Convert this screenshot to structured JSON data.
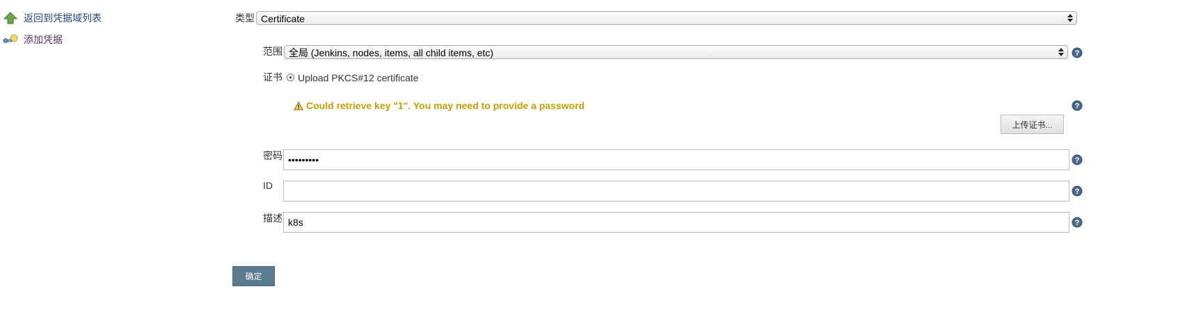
{
  "sidebar": {
    "back_label": "返回到凭据域列表",
    "add_label": "添加凭据"
  },
  "form": {
    "kind": {
      "label": "类型",
      "value": "Certificate"
    },
    "scope": {
      "label": "范围",
      "value": "全局 (Jenkins, nodes, items, all child items, etc)"
    },
    "certificate": {
      "label": "证书",
      "option_label": "Upload PKCS#12 certificate",
      "warning": "Could retrieve key \"1\". You may need to provide a password",
      "upload_button": "上传证书..."
    },
    "password": {
      "label": "密码",
      "value": "•••••••••"
    },
    "id": {
      "label": "ID",
      "value": ""
    },
    "description": {
      "label": "描述",
      "value": "k8s"
    },
    "submit_label": "确定"
  },
  "colors": {
    "link": "#204a87",
    "link_visited": "#5c3566",
    "warning": "#c4a000",
    "submit_bg": "#5a7b8f",
    "help_icon": "#4a6a8a"
  },
  "icons": {
    "back": "arrow-up-icon",
    "add": "key-icon",
    "help": "help-icon",
    "warning": "warning-icon"
  }
}
